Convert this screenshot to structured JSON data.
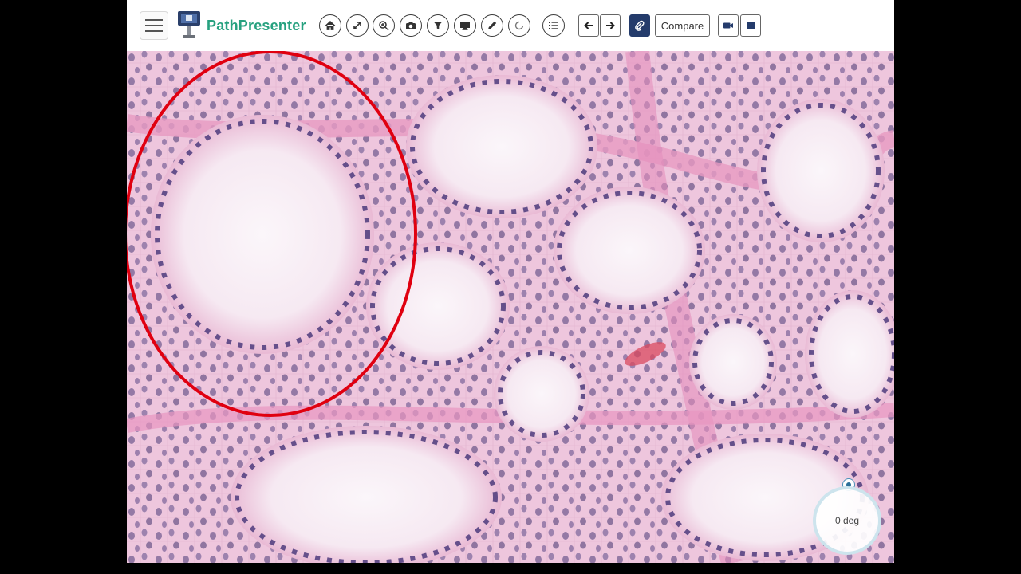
{
  "app": {
    "brand": "PathPresenter"
  },
  "toolbar": {
    "menu_icon": "hamburger-menu-icon",
    "tools": [
      {
        "name": "home-icon"
      },
      {
        "name": "fit-to-screen-icon"
      },
      {
        "name": "zoom-icon"
      },
      {
        "name": "camera-icon"
      },
      {
        "name": "filter-icon"
      },
      {
        "name": "monitor-icon"
      },
      {
        "name": "pencil-icon"
      },
      {
        "name": "rotate-icon"
      },
      {
        "name": "list-icon"
      }
    ],
    "prev_icon": "arrow-left-icon",
    "next_icon": "arrow-right-icon",
    "attach_icon": "paperclip-icon",
    "compare_label": "Compare",
    "record_icon": "video-camera-icon",
    "stop_icon": "stop-icon"
  },
  "viewer": {
    "annotation_color": "#e00010",
    "rotation_label": "0 deg"
  },
  "colors": {
    "brand": "#26a17f",
    "active_button": "#243b6b"
  }
}
